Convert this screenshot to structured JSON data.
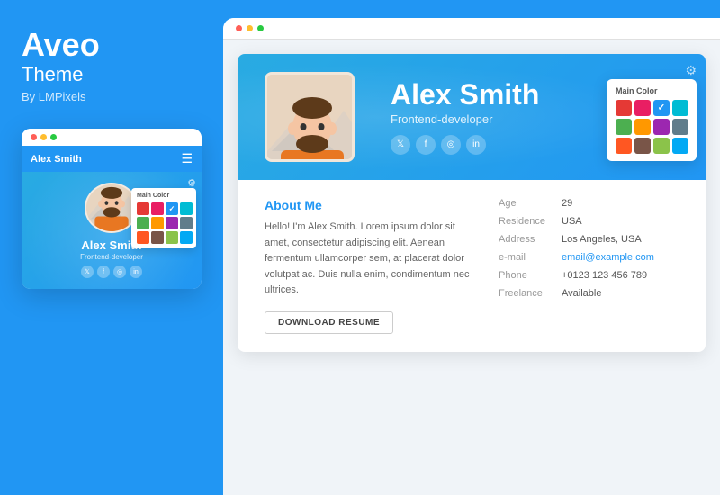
{
  "brand": {
    "title": "Aveo",
    "subtitle": "Theme",
    "by": "By LMPixels"
  },
  "phone": {
    "name": "Alex Smith",
    "nav_name": "Alex Smith",
    "role": "Frontend-developer",
    "social": [
      "𝕏",
      "f",
      "◎",
      "in"
    ],
    "gear_icon": "⚙",
    "color_picker_title": "Main Color"
  },
  "browser": {
    "dots": [
      "red",
      "yellow",
      "green"
    ]
  },
  "resume": {
    "name": "Alex Smith",
    "role": "Frontend-developer",
    "social": [
      "𝕏",
      "f",
      "◎",
      "in"
    ],
    "gear_icon": "⚙",
    "color_picker_title": "Main Color",
    "about_title_plain": "About ",
    "about_title_accent": "Me",
    "about_text": "Hello! I'm Alex Smith. Lorem ipsum dolor sit amet, consectetur adipiscing elit. Aenean fermentum ullamcorper sem, at placerat dolor volutpat ac. Duis nulla enim, condimentum nec ultrices.",
    "download_btn": "DOWNLOAD RESUME",
    "info": [
      {
        "label": "Age",
        "value": "29",
        "link": false
      },
      {
        "label": "Residence",
        "value": "USA",
        "link": false
      },
      {
        "label": "Address",
        "value": "Los Angeles, USA",
        "link": false
      },
      {
        "label": "e-mail",
        "value": "email@example.com",
        "link": true
      },
      {
        "label": "Phone",
        "value": "+0123 123 456 789",
        "link": false
      },
      {
        "label": "Freelance",
        "value": "Available",
        "link": false
      }
    ]
  },
  "color_swatches": [
    "#E53935",
    "#E91E63",
    "#2196F3",
    "#00BCD4",
    "#4CAF50",
    "#FF9800",
    "#9C27B0",
    "#607D8B",
    "#FF5722",
    "#795548",
    "#8BC34A",
    "#03A9F4"
  ],
  "active_color_index": 2
}
